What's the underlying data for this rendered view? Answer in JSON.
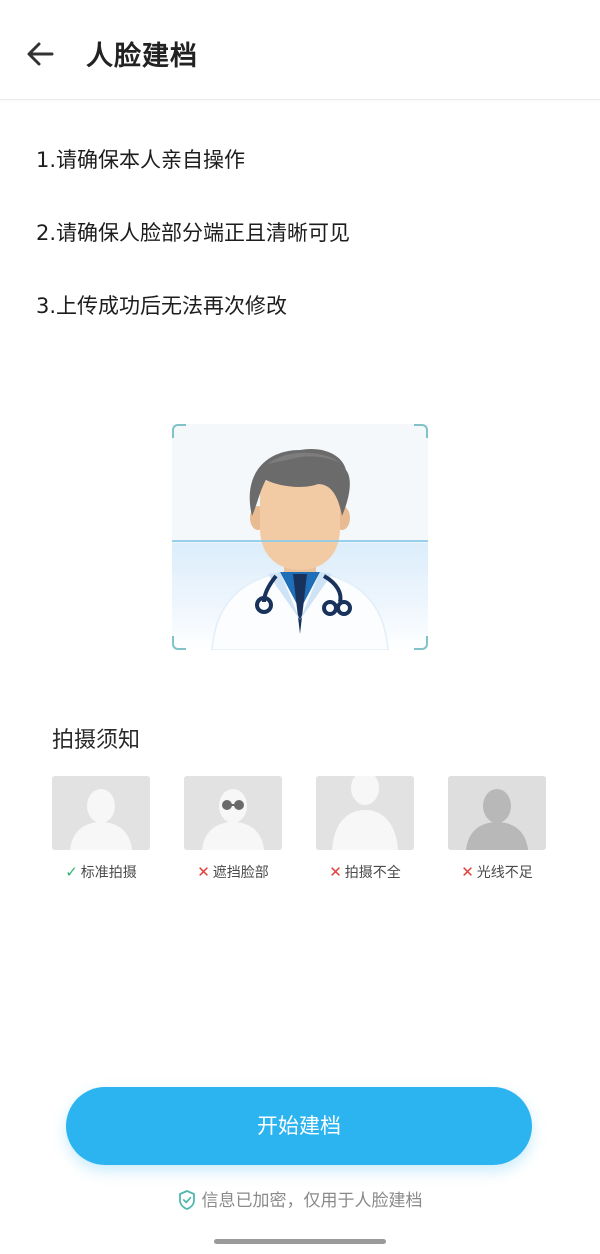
{
  "header": {
    "back_icon": "arrow-left-icon",
    "title": "人脸建档"
  },
  "tips": [
    "1.请确保本人亲自操作",
    "2.请确保人脸部分端正且清晰可见",
    "3.上传成功后无法再次修改"
  ],
  "scan_illustration": {
    "icon": "doctor-avatar-icon"
  },
  "notice": {
    "title": "拍摄须知",
    "samples": [
      {
        "label": "标准拍摄",
        "status": "ok",
        "mark": "✓",
        "icon": "standard-person-icon"
      },
      {
        "label": "遮挡脸部",
        "status": "bad",
        "mark": "✕",
        "icon": "face-covered-person-icon"
      },
      {
        "label": "拍摄不全",
        "status": "bad",
        "mark": "✕",
        "icon": "incomplete-person-icon"
      },
      {
        "label": "光线不足",
        "status": "bad",
        "mark": "✕",
        "icon": "dim-light-person-icon"
      }
    ]
  },
  "actions": {
    "start_label": "开始建档"
  },
  "footer": {
    "icon": "shield-check-icon",
    "text": "信息已加密，仅用于人脸建档"
  },
  "colors": {
    "accent": "#2cb4f0",
    "ok": "#2bb673",
    "bad": "#e0403a"
  }
}
